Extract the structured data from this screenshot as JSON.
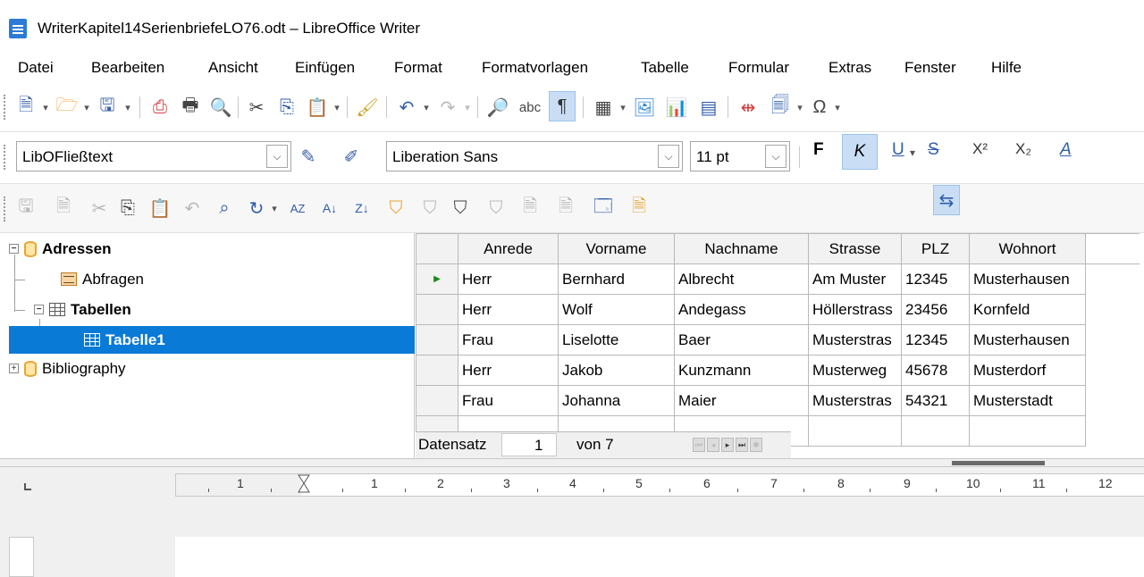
{
  "window": {
    "title": "WriterKapitel14SerienbriefeLO76.odt – LibreOffice Writer"
  },
  "menu": [
    "Datei",
    "Bearbeiten",
    "Ansicht",
    "Einfügen",
    "Format",
    "Formatvorlagen",
    "Tabelle",
    "Formular",
    "Extras",
    "Fenster",
    "Hilfe"
  ],
  "formatting": {
    "paragraph_style": "LibOFließtext",
    "font_name": "Liberation Sans",
    "font_size": "11 pt",
    "bold": "F",
    "italic": "K",
    "underline": "U",
    "strikethrough": "S",
    "superscript": "X²",
    "subscript": "X₂",
    "font_color": "A"
  },
  "datasource": {
    "items": [
      {
        "label": "Adressen"
      },
      {
        "label": "Abfragen"
      },
      {
        "label": "Tabellen"
      },
      {
        "label": "Tabelle1"
      },
      {
        "label": "Bibliography"
      }
    ]
  },
  "grid": {
    "columns": [
      "Anrede",
      "Vorname",
      "Nachname",
      "Strasse",
      "PLZ",
      "Wohnort"
    ],
    "rows": [
      [
        "Herr",
        "Bernhard",
        "Albrecht",
        "Am Muster",
        "12345",
        "Musterhausen"
      ],
      [
        "Herr",
        "Wolf",
        "Andegass",
        "Höllerstrass",
        "23456",
        "Kornfeld"
      ],
      [
        "Frau",
        "Liselotte",
        "Baer",
        "Musterstras",
        "12345",
        "Musterhausen"
      ],
      [
        "Herr",
        "Jakob",
        "Kunzmann",
        "Musterweg",
        "45678",
        "Musterdorf"
      ],
      [
        "Frau",
        "Johanna",
        "Maier",
        "Musterstras",
        "54321",
        "Musterstadt"
      ]
    ],
    "current_row_marker": "▶"
  },
  "navigation": {
    "record_label": "Datensatz",
    "record_number": "1",
    "of_label": "von 7"
  },
  "ruler": {
    "numbers": [
      "1",
      "1",
      "2",
      "3",
      "4",
      "5",
      "6",
      "7",
      "8",
      "9",
      "10",
      "11",
      "12"
    ]
  }
}
